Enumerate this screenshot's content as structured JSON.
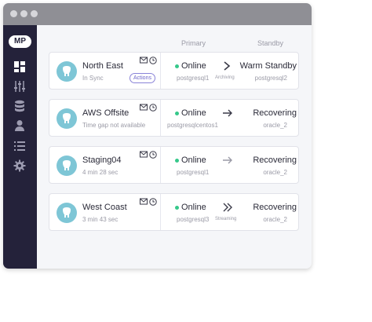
{
  "app": {
    "logo": "MP"
  },
  "columns": {
    "primary": "Primary",
    "standby": "Standby"
  },
  "sidebar": {
    "items": [
      {
        "icon": "dashboard-icon"
      },
      {
        "icon": "sliders-icon"
      },
      {
        "icon": "database-icon"
      },
      {
        "icon": "user-icon"
      },
      {
        "icon": "list-icon"
      },
      {
        "icon": "gear-icon"
      }
    ]
  },
  "rows": [
    {
      "name": "North East",
      "sub": "In Sync",
      "action": "Actions",
      "status": "Online",
      "primary_db": "postgresql1",
      "arrow": "chevron-right-icon",
      "mode": "Archiving",
      "standby_status": "Warm Standby",
      "standby_db": "postgresql2"
    },
    {
      "name": "AWS Offsite",
      "sub": "Time gap not available",
      "status": "Online",
      "primary_db": "postgresqlcentos1",
      "arrow": "arrow-right-icon",
      "standby_status": "Recovering",
      "standby_db": "oracle_2"
    },
    {
      "name": "Staging04",
      "sub": "4 min 28 sec",
      "status": "Online",
      "primary_db": "postgresql1",
      "arrow": "arrow-right-icon",
      "standby_status": "Recovering",
      "standby_db": "oracle_2"
    },
    {
      "name": "West Coast",
      "sub": "3 min 43 sec",
      "status": "Online",
      "primary_db": "postgresql3",
      "arrow": "double-chevron-right-icon",
      "mode": "Streaming",
      "standby_status": "Recovering",
      "standby_db": "oracle_2"
    }
  ],
  "colors": {
    "sidebar": "#24223a",
    "online": "#36c88a",
    "accent": "#6d66c8",
    "avatar": "#7ec6d6"
  }
}
